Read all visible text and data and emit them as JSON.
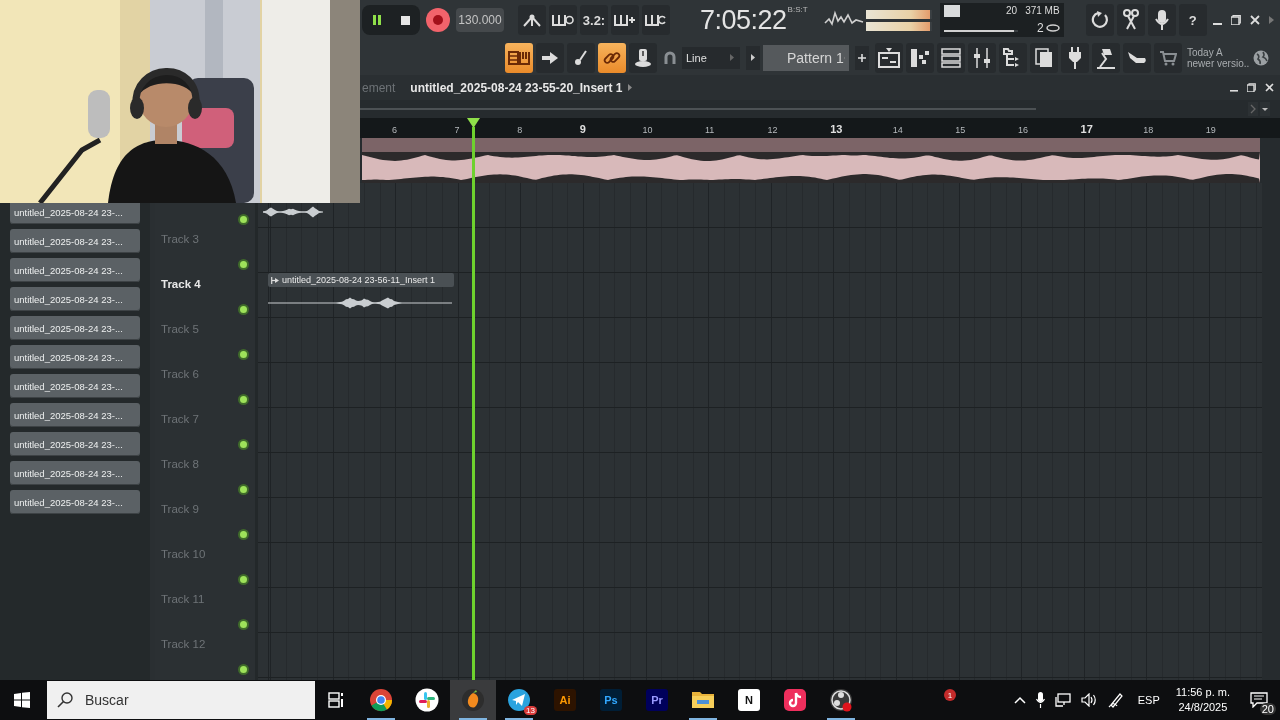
{
  "transport": {
    "playing": true,
    "recording": true,
    "tempo": "130.000",
    "time": "7:05:22",
    "time_format": "B:S:T"
  },
  "record_tools": [
    {
      "kind": "peak"
    },
    {
      "kind": "comb_clock"
    },
    {
      "kind": "countdown",
      "label": "3.2:"
    },
    {
      "kind": "comb_plus"
    },
    {
      "kind": "comb_loop"
    }
  ],
  "meters": [
    {
      "level": 0.97
    },
    {
      "level": 0.97
    }
  ],
  "cpu": {
    "value": "20",
    "memory": "371 MB",
    "polyphony": "2",
    "level": 0.95
  },
  "utility_buttons": [
    {
      "kind": "refresh"
    },
    {
      "kind": "scissors"
    },
    {
      "kind": "mic"
    },
    {
      "kind": "help",
      "label": "?"
    }
  ],
  "mode_buttons": [
    {
      "kind": "keyboard",
      "on": true
    },
    {
      "kind": "arrow",
      "on": false
    },
    {
      "kind": "brush",
      "on": false
    },
    {
      "kind": "link",
      "on": true
    },
    {
      "kind": "knob",
      "on": false
    }
  ],
  "snap": "Line",
  "pattern": "Pattern 1",
  "tool_buttons": [
    {
      "kind": "playlist"
    },
    {
      "kind": "steps"
    },
    {
      "kind": "list"
    },
    {
      "kind": "mixer"
    },
    {
      "kind": "tree"
    },
    {
      "kind": "pages"
    },
    {
      "kind": "plug"
    },
    {
      "kind": "lamp"
    },
    {
      "kind": "hand"
    },
    {
      "kind": "cart"
    }
  ],
  "hint": {
    "line_1": "Today  A",
    "line_2": "newer versio.."
  },
  "playlist": {
    "breadcrumb": "ement",
    "title": "untitled_2025-08-24 23-55-20_Insert 1",
    "ruler": [
      {
        "label": "6",
        "major": false
      },
      {
        "label": "7",
        "major": false
      },
      {
        "label": "8",
        "major": false
      },
      {
        "label": "9",
        "major": true
      },
      {
        "label": "10",
        "major": false
      },
      {
        "label": "11",
        "major": false
      },
      {
        "label": "12",
        "major": false
      },
      {
        "label": "13",
        "major": true
      },
      {
        "label": "14",
        "major": false
      },
      {
        "label": "15",
        "major": false
      },
      {
        "label": "16",
        "major": false
      },
      {
        "label": "17",
        "major": true
      },
      {
        "label": "18",
        "major": false
      },
      {
        "label": "19",
        "major": false
      }
    ],
    "tracks": [
      {
        "clip": {
          "kind": "waveform"
        }
      },
      {
        "name": "Track 3",
        "selected": false
      },
      {
        "name": "Track 4",
        "selected": true,
        "clip": {
          "kind": "labeled",
          "label": "untitled_2025-08-24 23-56-11_Insert 1"
        }
      },
      {
        "name": "Track 5",
        "selected": false
      },
      {
        "name": "Track 6",
        "selected": false
      },
      {
        "name": "Track 7",
        "selected": false
      },
      {
        "name": "Track 8",
        "selected": false
      },
      {
        "name": "Track 9",
        "selected": false
      },
      {
        "name": "Track 10",
        "selected": false
      },
      {
        "name": "Track 11",
        "selected": false
      },
      {
        "name": "Track 12",
        "selected": false
      }
    ]
  },
  "browser": {
    "items": [
      "untitled_2025-08-24 23-...",
      "untitled_2025-08-24 23-...",
      "untitled_2025-08-24 23-...",
      "untitled_2025-08-24 23-...",
      "untitled_2025-08-24 23-...",
      "untitled_2025-08-24 23-...",
      "untitled_2025-08-24 23-...",
      "untitled_2025-08-24 23-...",
      "untitled_2025-08-24 23-...",
      "untitled_2025-08-24 23-...",
      "untitled_2025-08-24 23-..."
    ]
  },
  "taskbar": {
    "search_placeholder": "Buscar",
    "apps": [
      {
        "kind": "chrome",
        "open": true,
        "selected": false
      },
      {
        "kind": "slack",
        "open": false,
        "selected": false
      },
      {
        "kind": "fruit",
        "open": true,
        "selected": true
      },
      {
        "kind": "telegram",
        "open": true,
        "selected": false,
        "badge": "13"
      },
      {
        "kind": "tile",
        "label": "Ai",
        "open": false,
        "selected": false
      },
      {
        "kind": "tile",
        "label": "Ps",
        "open": false,
        "selected": false
      },
      {
        "kind": "tile",
        "label": "Pr",
        "open": false,
        "selected": false
      },
      {
        "kind": "folder",
        "open": true,
        "selected": false
      },
      {
        "kind": "tile",
        "label": "N",
        "open": false,
        "selected": false
      },
      {
        "kind": "tiktok",
        "open": false,
        "selected": false
      },
      {
        "kind": "obs",
        "open": true,
        "selected": false
      }
    ],
    "badge": "1",
    "language": "ESP",
    "clock": "11:56 p. m.",
    "date": "24/8/2025",
    "notifications": "20"
  }
}
